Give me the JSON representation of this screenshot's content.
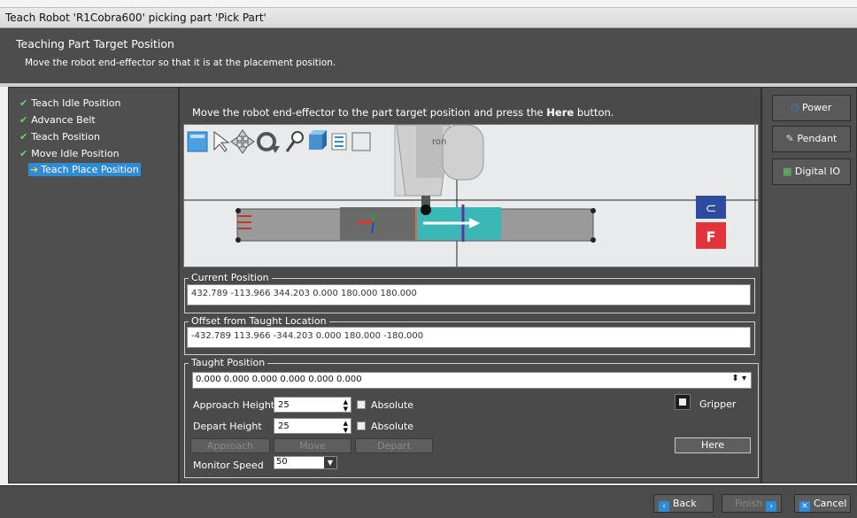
{
  "window": {
    "title": "Teach Robot 'R1Cobra600' picking part 'Pick Part'"
  },
  "header": {
    "title": "Teaching Part Target Position",
    "subtitle": "Move the robot end-effector so that it is at the placement position."
  },
  "steps": [
    {
      "label": "Teach Idle Position",
      "state": "done"
    },
    {
      "label": "Advance Belt",
      "state": "done"
    },
    {
      "label": "Teach Position",
      "state": "done"
    },
    {
      "label": "Move Idle Position",
      "state": "done"
    },
    {
      "label": "Teach Place Position",
      "state": "active"
    }
  ],
  "instruction": {
    "before": "Move the robot end-effector to the part target position and press the ",
    "bold": "Here",
    "after": " button."
  },
  "viewport": {
    "logo_text": "ron",
    "badge_top": "⊂",
    "badge_bottom": "F"
  },
  "current_position": {
    "legend": "Current Position",
    "value": "432.789 -113.966 344.203 0.000 180.000 180.000"
  },
  "offset": {
    "legend": "Offset from Taught Location",
    "value": "-432.789 113.966 -344.203 0.000 180.000 -180.000"
  },
  "taught": {
    "legend": "Taught Position",
    "value": "0.000 0.000 0.000 0.000 0.000 0.000",
    "approach_label": "Approach Height",
    "approach_value": "25",
    "depart_label": "Depart Height",
    "depart_value": "25",
    "absolute_label": "Absolute",
    "gripper_label": "Gripper",
    "approach_btn": "Approach",
    "move_btn": "Move",
    "depart_btn": "Depart",
    "here_btn": "Here",
    "speed_label": "Monitor Speed",
    "speed_value": "50"
  },
  "right": {
    "power": "Power",
    "pendant": "Pendant",
    "digital_io": "Digital IO"
  },
  "footer": {
    "back": "Back",
    "finish": "Finish",
    "cancel": "Cancel"
  },
  "colors": {
    "accent": "#2e8bd8",
    "check": "#6fd06f",
    "panel": "#4a4a4a"
  }
}
